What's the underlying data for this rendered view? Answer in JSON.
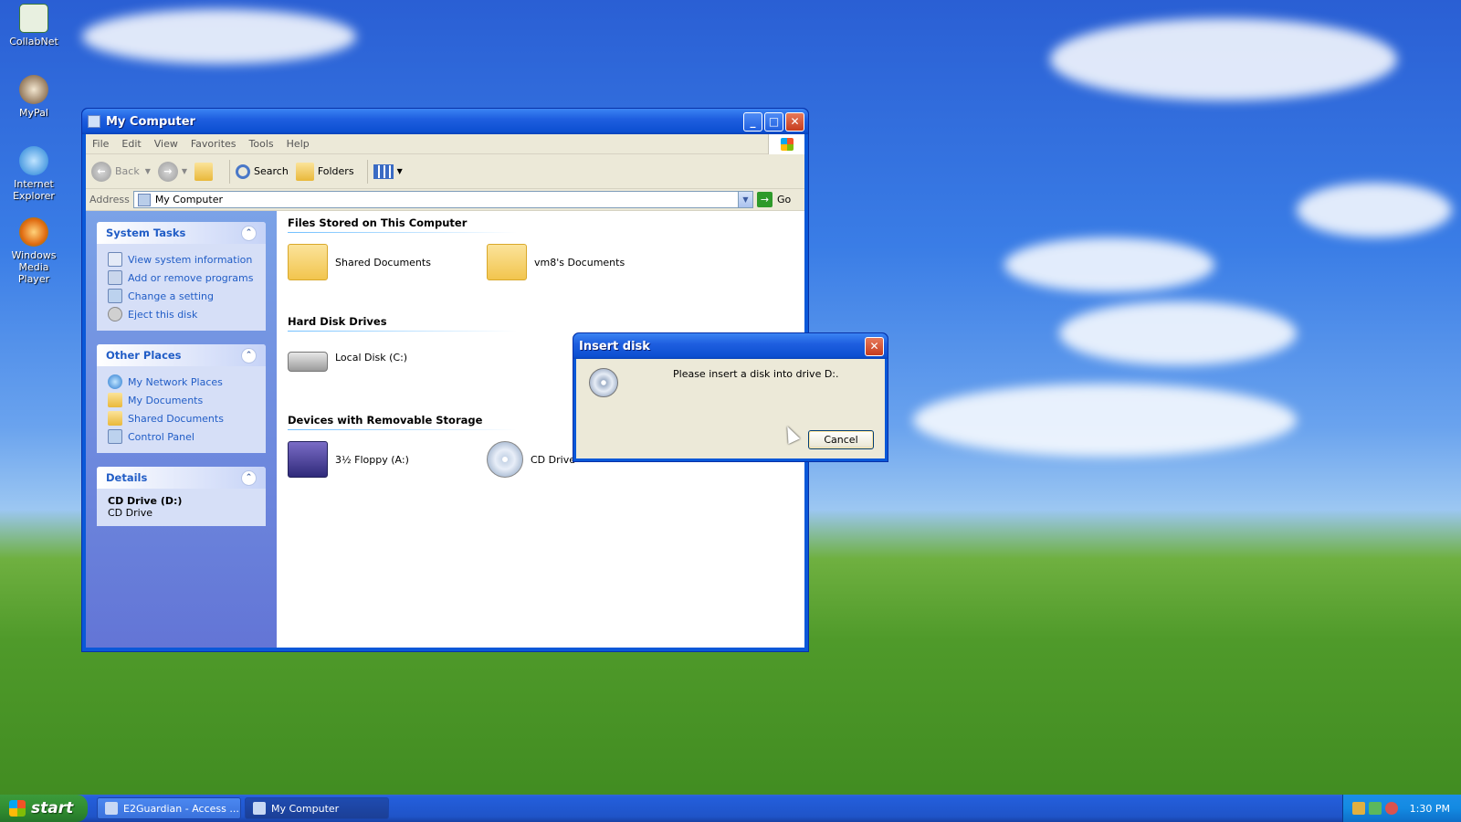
{
  "desktop": {
    "icons": [
      {
        "label": "CollabNet"
      },
      {
        "label": "MyPal"
      },
      {
        "label": "Internet Explorer"
      },
      {
        "label": "Windows Media Player"
      }
    ]
  },
  "window": {
    "title": "My Computer",
    "menu": [
      "File",
      "Edit",
      "View",
      "Favorites",
      "Tools",
      "Help"
    ],
    "toolbar": {
      "back": "Back",
      "search": "Search",
      "folders": "Folders"
    },
    "address": {
      "label": "Address",
      "value": "My Computer",
      "go": "Go"
    },
    "sidebar": {
      "system_tasks": {
        "title": "System Tasks",
        "items": [
          "View system information",
          "Add or remove programs",
          "Change a setting",
          "Eject this disk"
        ]
      },
      "other_places": {
        "title": "Other Places",
        "items": [
          "My Network Places",
          "My Documents",
          "Shared Documents",
          "Control Panel"
        ]
      },
      "details": {
        "title": "Details",
        "name": "CD Drive (D:)",
        "type": "CD Drive"
      }
    },
    "groups": [
      {
        "title": "Files Stored on This Computer",
        "items": [
          "Shared Documents",
          "vm8's Documents"
        ]
      },
      {
        "title": "Hard Disk Drives",
        "items": [
          "Local Disk (C:)"
        ]
      },
      {
        "title": "Devices with Removable Storage",
        "items": [
          "3½ Floppy (A:)",
          "CD Drive"
        ]
      }
    ]
  },
  "dialog": {
    "title": "Insert disk",
    "message": "Please insert a disk into drive D:.",
    "cancel": "Cancel"
  },
  "taskbar": {
    "start": "start",
    "tasks": [
      "E2Guardian - Access ...",
      "My Computer"
    ],
    "clock": "1:30 PM"
  },
  "colors": {
    "accent": "#0a58d8",
    "link": "#215dc6",
    "start_green": "#2f8a2f"
  }
}
